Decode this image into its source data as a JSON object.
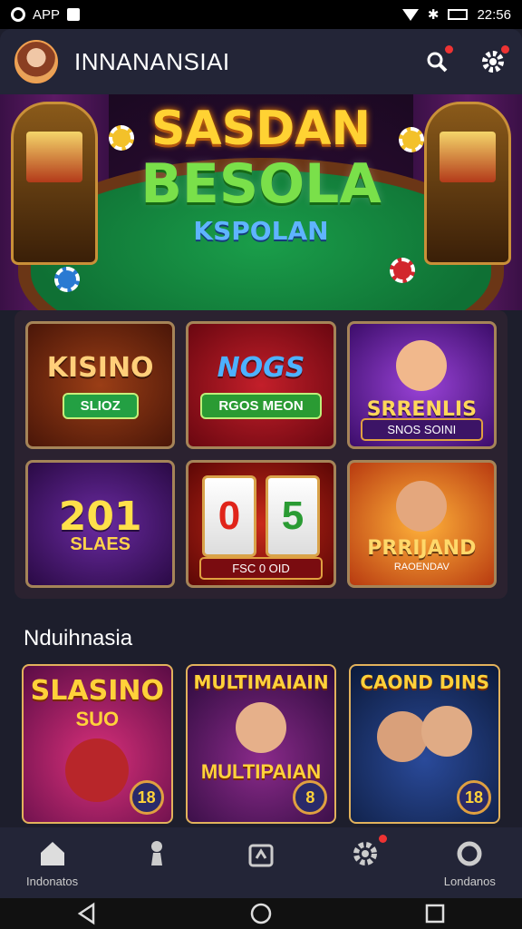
{
  "status_bar": {
    "app_label": "APP",
    "time": "22:56"
  },
  "header": {
    "title": "INNANANSIAI"
  },
  "hero": {
    "line1": "SASDAN",
    "line2": "BESOLA",
    "line3": "KSPOLAN"
  },
  "grid": {
    "tiles": [
      {
        "name": "KISINO",
        "button": "SLIOZ"
      },
      {
        "name": "NOGS",
        "button": "RGOS MEON"
      },
      {
        "name": "SRRENLIS",
        "sub": "SNOS SOINI"
      },
      {
        "name": "201",
        "sub": "SLAES"
      },
      {
        "reel_left": "0",
        "reel_right": "5",
        "sub": "FSC 0 OID"
      },
      {
        "name": "PRRIJAND",
        "sub": "RAOENDAV"
      }
    ]
  },
  "section": {
    "title": "Nduihnasia",
    "cards": [
      {
        "title": "SLASINO",
        "sub": "SUO",
        "badge": "18"
      },
      {
        "title": "MULTIMAIAIN",
        "sub": "MULTIPAIAN",
        "badge": "8"
      },
      {
        "title": "CAOND DINS",
        "badge": "18"
      }
    ]
  },
  "bottom_nav": {
    "items": [
      {
        "label": "Indonatos",
        "icon": "home-icon"
      },
      {
        "label": "",
        "icon": "chess-piece-icon"
      },
      {
        "label": "",
        "icon": "bag-icon"
      },
      {
        "label": "",
        "icon": "gear-icon"
      },
      {
        "label": "Londanos",
        "icon": "circle-icon"
      }
    ]
  },
  "colors": {
    "accent_red": "#e33333",
    "gold": "#ffd233",
    "bg": "#1d1e2c"
  }
}
